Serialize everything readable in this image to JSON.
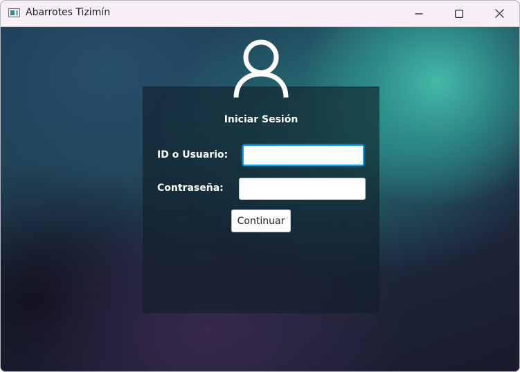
{
  "window": {
    "title": "Abarrotes Tizimín",
    "icon": "app-window-icon",
    "controls": {
      "minimize_icon": "minimize-icon",
      "maximize_icon": "maximize-icon",
      "close_icon": "close-icon"
    }
  },
  "login": {
    "avatar_icon": "user-icon",
    "title": "Iniciar Sesión",
    "user_label": "ID o Usuario:",
    "user_value": "",
    "password_label": "Contraseña:",
    "password_value": "",
    "continue_label": "Continuar"
  },
  "colors": {
    "focus_border": "#1aa0e8",
    "panel_background": "rgba(16,30,40,0.62)",
    "text_on_panel": "#ffffff"
  }
}
